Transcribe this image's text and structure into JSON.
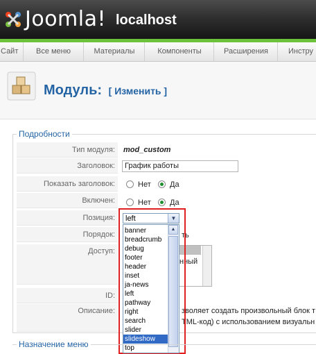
{
  "header": {
    "logo_text": "Joomla!",
    "site_name": "localhost"
  },
  "menu": [
    "Сайт",
    "Все меню",
    "Материалы",
    "Компоненты",
    "Расширения",
    "Инстру"
  ],
  "title": {
    "main": "Модуль:",
    "action": "[ Изменить ]"
  },
  "details": {
    "legend": "Подробности",
    "type_label": "Тип модуля:",
    "type_value": "mod_custom",
    "heading_label": "Заголовок:",
    "heading_value": "График работы",
    "show_title_label": "Показать заголовок:",
    "enabled_label": "Включен:",
    "no": "Нет",
    "yes": "Да",
    "position_label": "Позиция:",
    "position_value": "left",
    "order_label": "Порядок:",
    "order_value_partial": "ть",
    "access_label": "Доступ:",
    "access_partial": "нный",
    "id_label": "ID:",
    "description_label": "Описание:",
    "description_line1": "зволяет создать произвольный блок т",
    "description_line2": "TML-код) с использованием визуальн"
  },
  "position_options": [
    "banner",
    "breadcrumb",
    "debug",
    "footer",
    "header",
    "inset",
    "ja-news",
    "left",
    "pathway",
    "right",
    "search",
    "slider",
    "slideshow",
    "top"
  ],
  "assign": {
    "legend": "Назначение меню"
  },
  "colors": {
    "accent": "#2464a4",
    "green": "#6cc23b",
    "highlight_border": "#e02020",
    "selected_option": "#316ac5"
  }
}
